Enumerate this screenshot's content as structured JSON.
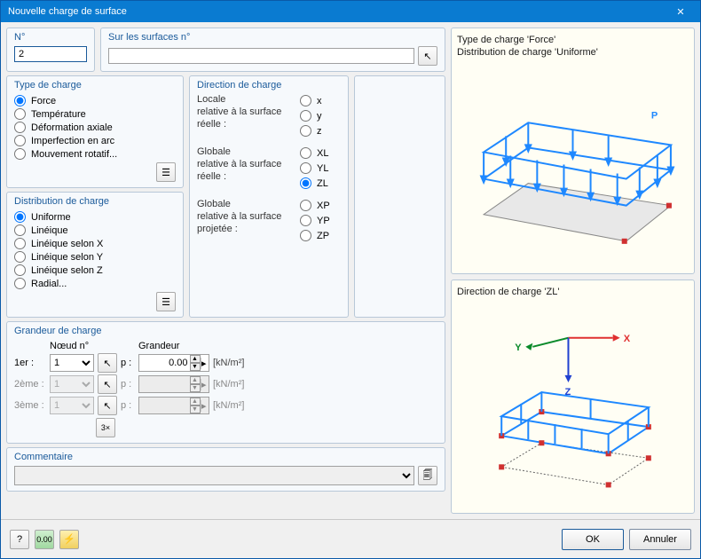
{
  "title": "Nouvelle charge de surface",
  "numero": {
    "label": "N°",
    "value": "2"
  },
  "surfaces": {
    "label": "Sur les surfaces n°",
    "value": ""
  },
  "type_charge": {
    "title": "Type de charge",
    "options": [
      "Force",
      "Température",
      "Déformation axiale",
      "Imperfection en arc",
      "Mouvement rotatif..."
    ],
    "selected": "Force"
  },
  "distribution": {
    "title": "Distribution de charge",
    "options": [
      "Uniforme",
      "Linéique",
      "Linéique selon X",
      "Linéique selon Y",
      "Linéique selon Z",
      "Radial..."
    ],
    "selected": "Uniforme"
  },
  "direction": {
    "title": "Direction de charge",
    "groups": [
      {
        "label": "Locale\nrelative à la surface réelle :",
        "opts": [
          "x",
          "y",
          "z"
        ]
      },
      {
        "label": "Globale\nrelative à la surface réelle :",
        "opts": [
          "XL",
          "YL",
          "ZL"
        ]
      },
      {
        "label": "Globale\nrelative à la surface projetée :",
        "opts": [
          "XP",
          "YP",
          "ZP"
        ]
      }
    ],
    "selected": "ZL"
  },
  "grandeur": {
    "title": "Grandeur de charge",
    "col_noeud": "Nœud n°",
    "col_grandeur": "Grandeur",
    "rows": [
      {
        "label": "1er :",
        "noeud": "1",
        "p": "p :",
        "value": "0.00",
        "unit": "[kN/m²]",
        "enabled": true
      },
      {
        "label": "2ème :",
        "noeud": "1",
        "p": "p :",
        "value": "",
        "unit": "[kN/m²]",
        "enabled": false
      },
      {
        "label": "3ème :",
        "noeud": "1",
        "p": "p :",
        "value": "",
        "unit": "[kN/m²]",
        "enabled": false
      }
    ]
  },
  "commentaire": {
    "title": "Commentaire",
    "value": ""
  },
  "preview_top": {
    "line1": "Type de charge 'Force'",
    "line2": "Distribution de charge 'Uniforme'",
    "badge": "P"
  },
  "preview_bottom": {
    "line1": "Direction de charge 'ZL'",
    "x": "X",
    "y": "Y",
    "z": "Z"
  },
  "buttons": {
    "ok": "OK",
    "cancel": "Annuler"
  }
}
